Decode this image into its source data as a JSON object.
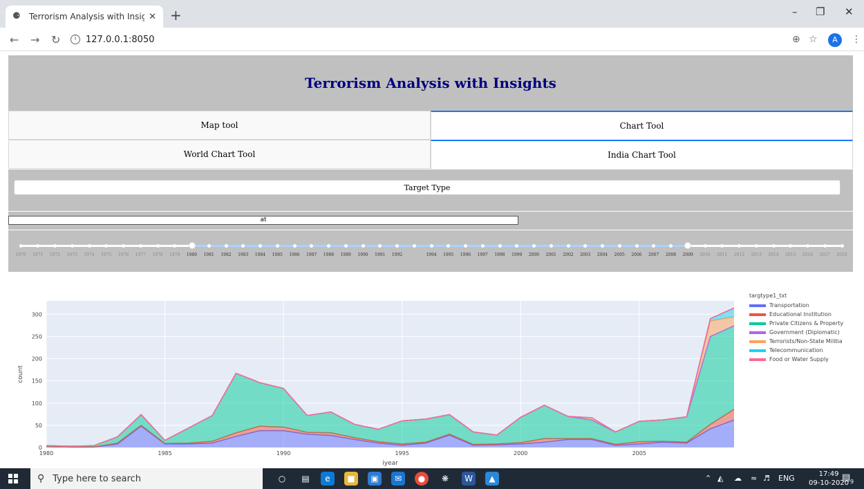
{
  "browser": {
    "tab_title": "Terrorism Analysis with Insights",
    "url": "127.0.0.1:8050",
    "avatar_letter": "A"
  },
  "app": {
    "title": "Terrorism Analysis with Insights",
    "tabs_row1": [
      {
        "label": "Map tool",
        "selected": false
      },
      {
        "label": "Chart Tool",
        "selected": true
      }
    ],
    "tabs_row2": [
      {
        "label": "World Chart Tool",
        "selected": false
      },
      {
        "label": "India Chart Tool",
        "selected": true
      }
    ],
    "dropdown_value": "Target Type",
    "search_value": "at",
    "slider": {
      "years": [
        "1970",
        "1971",
        "1972",
        "1973",
        "1974",
        "1975",
        "1976",
        "1977",
        "1978",
        "1979",
        "1980",
        "1981",
        "1982",
        "1983",
        "1984",
        "1985",
        "1986",
        "1987",
        "1988",
        "1989",
        "1990",
        "1991",
        "1992",
        "",
        "1994",
        "1995",
        "1996",
        "1997",
        "1998",
        "1999",
        "2000",
        "2001",
        "2002",
        "2003",
        "2004",
        "2005",
        "2006",
        "2007",
        "2008",
        "2009",
        "2010",
        "2011",
        "2012",
        "2013",
        "2014",
        "2015",
        "2016",
        "2017",
        "2018"
      ],
      "range_start": "1980",
      "range_end": "2009"
    }
  },
  "chart_data": {
    "type": "area",
    "xlabel": "iyear",
    "ylabel": "count",
    "legend_title": "targtype1_txt",
    "legend_position": "right",
    "grid": true,
    "xlim": [
      1980,
      2009
    ],
    "ylim": [
      0,
      330
    ],
    "x_ticks": [
      1980,
      1985,
      1990,
      1995,
      2000,
      2005
    ],
    "y_ticks": [
      0,
      50,
      100,
      150,
      200,
      250,
      300
    ],
    "x": [
      1980,
      1981,
      1982,
      1983,
      1984,
      1985,
      1986,
      1987,
      1988,
      1989,
      1990,
      1991,
      1992,
      1993,
      1994,
      1995,
      1996,
      1997,
      1998,
      1999,
      2000,
      2001,
      2002,
      2003,
      2004,
      2005,
      2006,
      2007,
      2008,
      2009
    ],
    "series": [
      {
        "name": "Transportation",
        "color": "#636efa",
        "values": [
          2,
          1,
          1,
          8,
          48,
          8,
          8,
          10,
          25,
          38,
          38,
          30,
          27,
          18,
          10,
          5,
          10,
          28,
          5,
          6,
          8,
          12,
          18,
          18,
          5,
          8,
          12,
          10,
          42,
          62
        ]
      },
      {
        "name": "Educational Institution",
        "color": "#ef553b",
        "values": [
          0,
          0,
          0,
          2,
          2,
          1,
          2,
          4,
          8,
          10,
          8,
          4,
          6,
          4,
          3,
          3,
          2,
          2,
          2,
          2,
          3,
          8,
          2,
          2,
          2,
          5,
          2,
          2,
          10,
          24
        ]
      },
      {
        "name": "Private Citizens & Property",
        "color": "#00cc96",
        "values": [
          2,
          2,
          3,
          14,
          24,
          7,
          34,
          58,
          134,
          98,
          87,
          38,
          47,
          30,
          28,
          52,
          52,
          44,
          28,
          20,
          57,
          75,
          50,
          42,
          28,
          46,
          48,
          57,
          198,
          188
        ]
      },
      {
        "name": "Government (Diplomatic)",
        "color": "#ab63fa",
        "values": [
          0,
          0,
          0,
          0,
          0,
          0,
          0,
          0,
          0,
          0,
          0,
          0,
          0,
          0,
          0,
          0,
          0,
          0,
          0,
          0,
          0,
          0,
          0,
          0,
          0,
          0,
          0,
          0,
          0,
          0
        ]
      },
      {
        "name": "Terrorists/Non-State Militia",
        "color": "#ffa15a",
        "values": [
          0,
          0,
          0,
          0,
          0,
          0,
          0,
          0,
          0,
          0,
          0,
          0,
          0,
          0,
          0,
          0,
          0,
          0,
          0,
          0,
          0,
          0,
          0,
          5,
          0,
          0,
          0,
          0,
          35,
          20
        ]
      },
      {
        "name": "Telecommunication",
        "color": "#19d3f3",
        "values": [
          0,
          0,
          0,
          0,
          0,
          0,
          0,
          0,
          0,
          0,
          0,
          0,
          0,
          0,
          0,
          0,
          0,
          0,
          0,
          0,
          0,
          0,
          0,
          0,
          0,
          0,
          0,
          0,
          5,
          20
        ]
      },
      {
        "name": "Food or Water Supply",
        "color": "#ff6692",
        "values": [
          0,
          0,
          0,
          0,
          0,
          0,
          0,
          0,
          0,
          0,
          0,
          0,
          0,
          0,
          0,
          0,
          0,
          0,
          0,
          0,
          0,
          0,
          0,
          0,
          0,
          0,
          0,
          0,
          0,
          0
        ]
      }
    ]
  },
  "taskbar": {
    "search_placeholder": "Type here to search",
    "lang": "ENG",
    "time": "17:49",
    "date": "09-10-2020",
    "notif_count": "9"
  }
}
